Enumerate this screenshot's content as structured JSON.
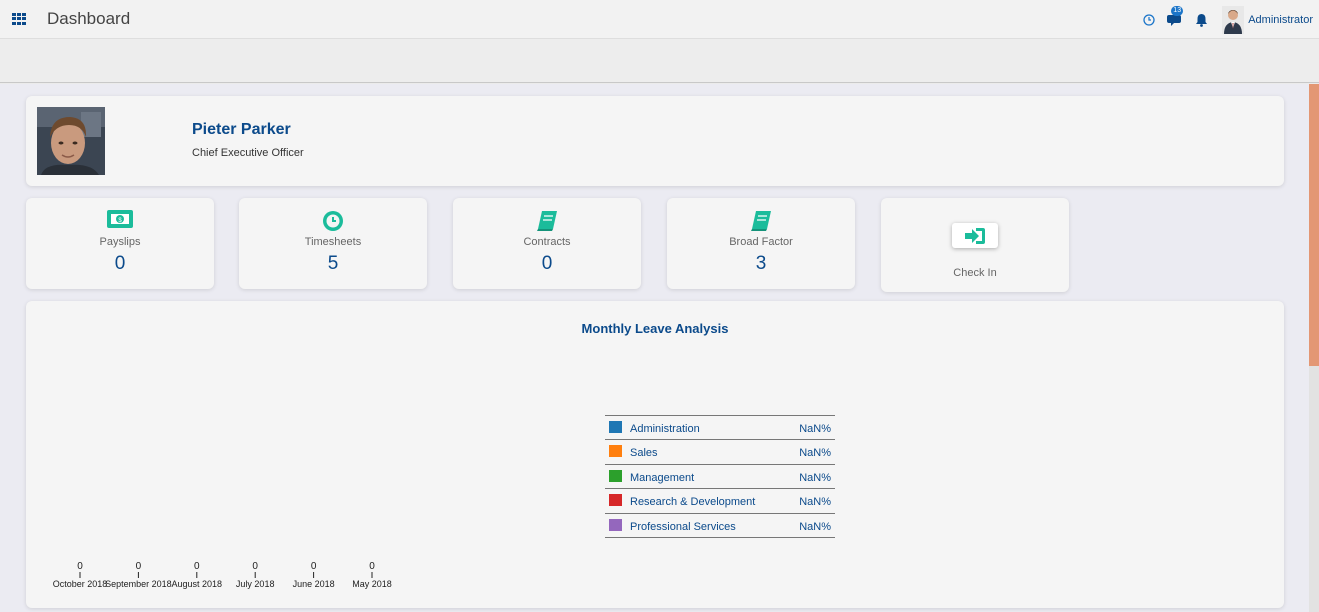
{
  "topbar": {
    "title": "Dashboard",
    "icons": [
      "apps-grid-icon",
      "clock-icon",
      "chat-icon",
      "bell-icon"
    ],
    "messages_badge": "13",
    "user_name": "Administrator"
  },
  "profile": {
    "name": "Pieter Parker",
    "role": "Chief Executive Officer"
  },
  "stats": [
    {
      "label": "Payslips",
      "value": "0",
      "icon": "money-icon"
    },
    {
      "label": "Timesheets",
      "value": "5",
      "icon": "clock-icon"
    },
    {
      "label": "Contracts",
      "value": "0",
      "icon": "book-icon"
    },
    {
      "label": "Broad Factor",
      "value": "3",
      "icon": "book-icon"
    }
  ],
  "checkin": {
    "label": "Check In",
    "icon": "sign-in-icon"
  },
  "chart_data": {
    "type": "bar",
    "title": "Monthly Leave Analysis",
    "categories": [
      "October 2018",
      "September 2018",
      "August 2018",
      "July 2018",
      "June 2018",
      "May 2018"
    ],
    "values": [
      0,
      0,
      0,
      0,
      0,
      0
    ],
    "legend": [
      {
        "label": "Administration",
        "value": "NaN%",
        "color": "#1f77b4"
      },
      {
        "label": "Sales",
        "value": "NaN%",
        "color": "#ff7f0e"
      },
      {
        "label": "Management",
        "value": "NaN%",
        "color": "#2ca02c"
      },
      {
        "label": "Research & Development",
        "value": "NaN%",
        "color": "#d62728"
      },
      {
        "label": "Professional Services",
        "value": "NaN%",
        "color": "#9467bd"
      }
    ]
  },
  "colors": {
    "accent": "#0b4a8b",
    "icon_green": "#1bbc9b",
    "scroll_thumb": "#e39774"
  }
}
